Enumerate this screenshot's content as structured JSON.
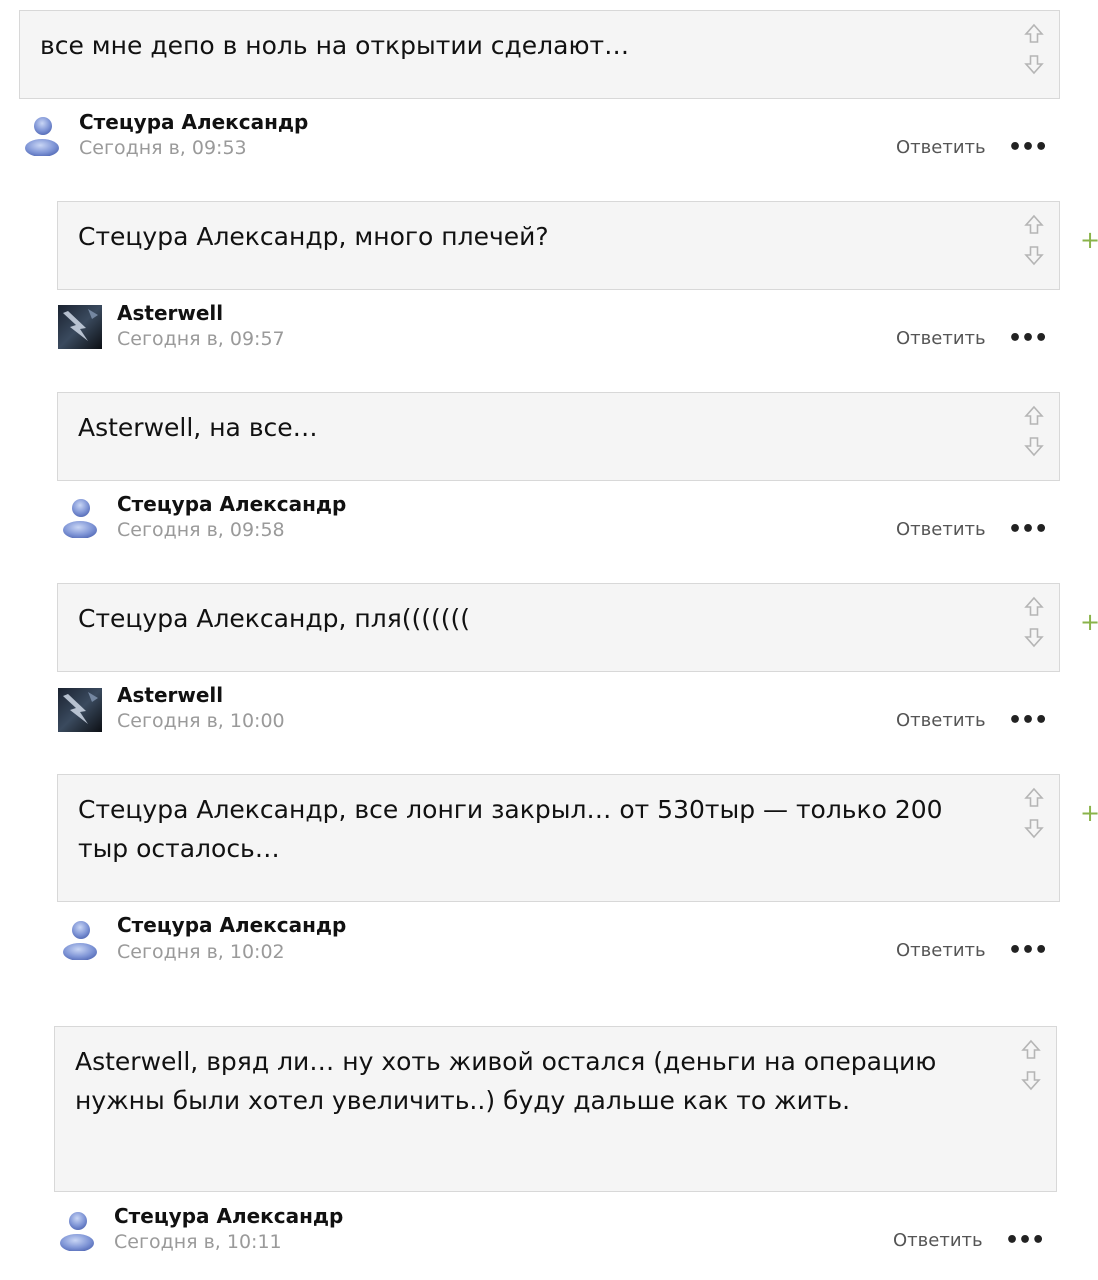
{
  "ui": {
    "reply_label": "Ответить",
    "more_label": "•••",
    "plus_label": "+"
  },
  "comments": [
    {
      "text": "все мне депо в ноль на открытии сделают…",
      "author": "Стецура Александр",
      "time": "Сегодня в, 09:53",
      "avatar": "user-silhouette-icon"
    },
    {
      "text": "Стецура Александр, много плечей?",
      "author": "Asterwell",
      "time": "Сегодня в, 09:57",
      "avatar": "asterwell-avatar"
    },
    {
      "text": "Asterwell, на все…",
      "author": "Стецура Александр",
      "time": "Сегодня в, 09:58",
      "avatar": "user-silhouette-icon"
    },
    {
      "text": "Стецура Александр, пля(((((((",
      "author": "Asterwell",
      "time": "Сегодня в, 10:00",
      "avatar": "asterwell-avatar"
    },
    {
      "text": "Стецура Александр, все лонги закрыл… от 530тыр  — только 200 тыр осталось…",
      "author": "Стецура Александр",
      "time": "Сегодня в, 10:02",
      "avatar": "user-silhouette-icon"
    },
    {
      "text": "Asterwell, вряд ли… ну хоть живой остался (деньги на операцию нужны были хотел увеличить..) буду дальше как то жить.",
      "author": "Стецура Александр",
      "time": "Сегодня в, 10:11",
      "avatar": "user-silhouette-icon"
    }
  ]
}
